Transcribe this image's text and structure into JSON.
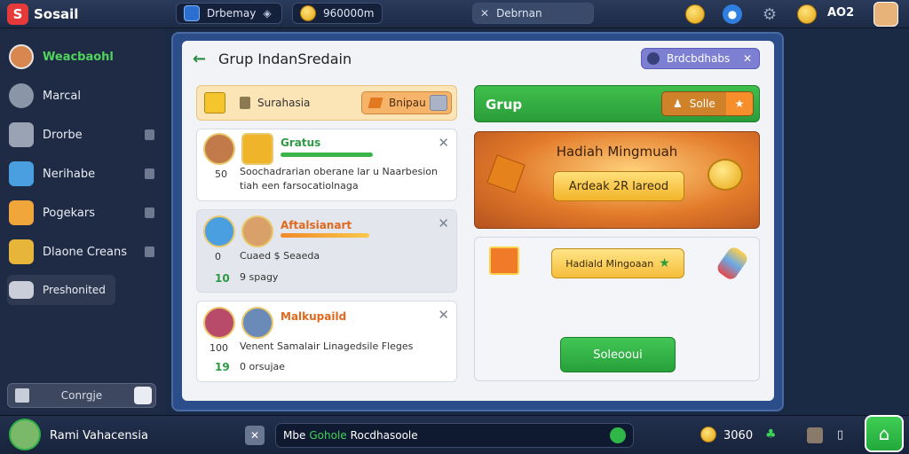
{
  "topbar": {
    "app_name": "Sosail",
    "search_text": "Drbemay",
    "coins_text": "960000m",
    "edit_text": "Debrnan",
    "level_text": "AO2"
  },
  "sidebar": {
    "items": [
      {
        "label": "Weacbaohl",
        "icon": "profile-avatar-icon"
      },
      {
        "label": "Marcal",
        "icon": "gear-icon"
      },
      {
        "label": "Drorbe",
        "icon": "cube-icon"
      },
      {
        "label": "Nerihabe",
        "icon": "character-icon"
      },
      {
        "label": "Pogekars",
        "icon": "gift-icon"
      },
      {
        "label": "Dlaone Creans",
        "icon": "chest-icon"
      },
      {
        "label": "Preshonited",
        "icon": "board-icon"
      }
    ],
    "bottom_label": "Conrgje"
  },
  "panel": {
    "title": "Grup IndanSredain",
    "details_label": "Brdcbdhabs",
    "filter_label": "Surahasia",
    "filter_button": "Bnipau",
    "cards": [
      {
        "name": "Gratus",
        "name_color": "#2d9a43",
        "num": "50",
        "text": "Soochadrarian oberane lar u Naarbesion tiah een farsocatiolnaga",
        "green_num": "",
        "small": ""
      },
      {
        "name": "Aftalsianart",
        "name_color": "#e0681c",
        "num": "0",
        "text": "Cuaed $ Seaeda",
        "green_num": "10",
        "small": "9 spagy"
      },
      {
        "name": "Malkupaild",
        "name_color": "#e0681c",
        "num": "100",
        "text": "Venent Samalair Linagedsile Fleges",
        "green_num": "19",
        "small": "0 orsujae"
      }
    ],
    "grup_label": "Grup",
    "grup_button": "Solle",
    "reward_title": "Hadiah Mingmuah",
    "reward_button": "Ardeak 2R lareod",
    "gift_button": "Hadiald Mingoaan",
    "green_button": "Soleooui"
  },
  "bottombar": {
    "player_name": "Rami Vahacensia",
    "chat_prefix": "Mbe",
    "chat_highlight": "Gohole",
    "chat_text": "Rocdhasoole",
    "coins": "3060"
  }
}
